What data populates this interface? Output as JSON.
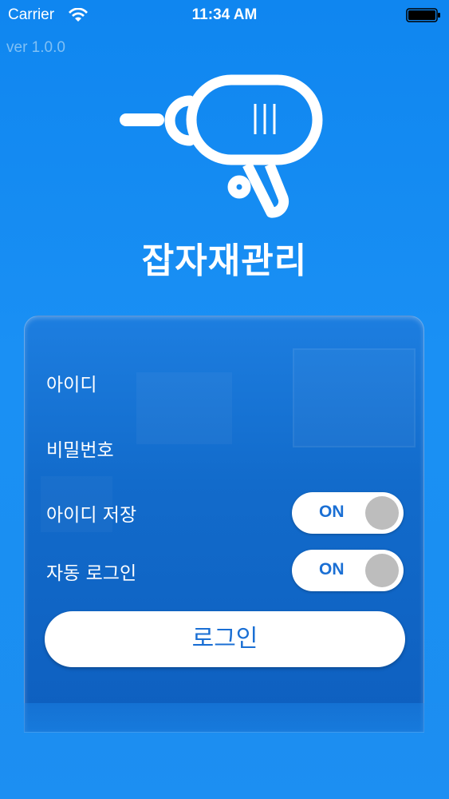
{
  "status_bar": {
    "carrier": "Carrier",
    "time": "11:34 AM"
  },
  "version": "ver 1.0.0",
  "app": {
    "title": "잡자재관리"
  },
  "form": {
    "id_label": "아이디",
    "password_label": "비밀번호",
    "save_id_label": "아이디 저장",
    "save_id_toggle": "ON",
    "auto_login_label": "자동 로그인",
    "auto_login_toggle": "ON",
    "login_button": "로그인"
  },
  "colors": {
    "background": "#1a90f4",
    "accent": "#1a6fd4",
    "knob": "#bdbdbd"
  }
}
